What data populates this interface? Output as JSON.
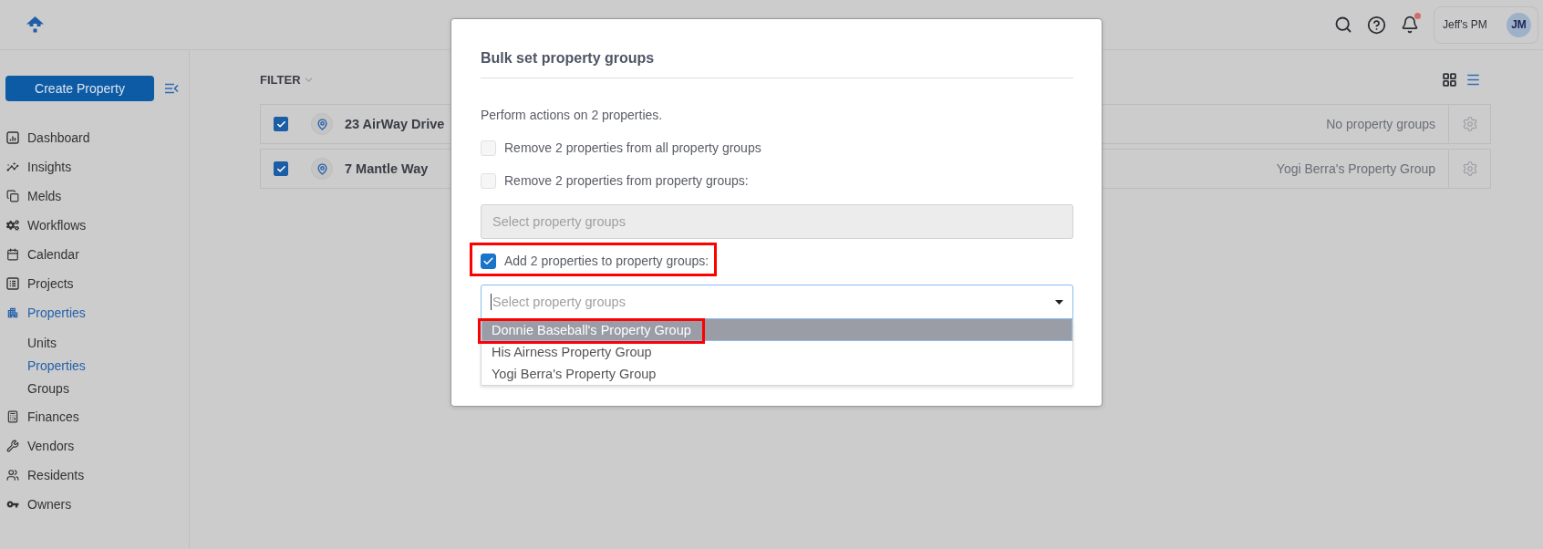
{
  "header": {
    "notification_unread": true,
    "user_name": "Jeff's PM",
    "avatar_initials": "JM"
  },
  "sidebar": {
    "create_button": "Create Property",
    "items": [
      {
        "label": "Dashboard",
        "selected": false
      },
      {
        "label": "Insights",
        "selected": false
      },
      {
        "label": "Melds",
        "selected": false
      },
      {
        "label": "Workflows",
        "selected": false
      },
      {
        "label": "Calendar",
        "selected": false
      },
      {
        "label": "Projects",
        "selected": false
      },
      {
        "label": "Properties",
        "selected": true,
        "children": [
          {
            "label": "Units",
            "selected": false
          },
          {
            "label": "Properties",
            "selected": true
          },
          {
            "label": "Groups",
            "selected": false
          }
        ]
      },
      {
        "label": "Finances",
        "selected": false
      },
      {
        "label": "Vendors",
        "selected": false
      },
      {
        "label": "Residents",
        "selected": false
      },
      {
        "label": "Owners",
        "selected": false
      }
    ]
  },
  "toolbar": {
    "filter_label": "FILTER",
    "views": [
      {
        "kind": "grid",
        "selected": false
      },
      {
        "kind": "list",
        "selected": true
      }
    ]
  },
  "table": {
    "rows": [
      {
        "checked": true,
        "name": "23 AirWay Drive",
        "groups": "No property groups"
      },
      {
        "checked": true,
        "name": "7 Mantle Way",
        "groups": "Yogi Berra's Property Group"
      }
    ]
  },
  "modal": {
    "title": "Bulk set property groups",
    "intro": "Perform actions on 2 properties.",
    "options": [
      {
        "kind": "checkbox",
        "label": "Remove 2 properties from all property groups",
        "checked": false,
        "annotated": false
      },
      {
        "kind": "checkbox",
        "label": "Remove 2 properties from property groups:",
        "checked": false,
        "annotated": false
      },
      {
        "kind": "select",
        "placeholder": "Select property groups",
        "disabled": true,
        "focused": false,
        "expanded": false
      },
      {
        "kind": "checkbox",
        "label": "Add 2 properties to property groups:",
        "checked": true,
        "annotated": true
      },
      {
        "kind": "select",
        "placeholder": "Select property groups",
        "disabled": false,
        "focused": true,
        "expanded": true,
        "menu": [
          {
            "label": "Donnie Baseball's Property Group",
            "selected": true,
            "annotated": true
          },
          {
            "label": "His Airness Property Group",
            "selected": false,
            "annotated": false
          },
          {
            "label": "Yogi Berra's Property Group",
            "selected": false,
            "annotated": false
          }
        ]
      }
    ]
  }
}
